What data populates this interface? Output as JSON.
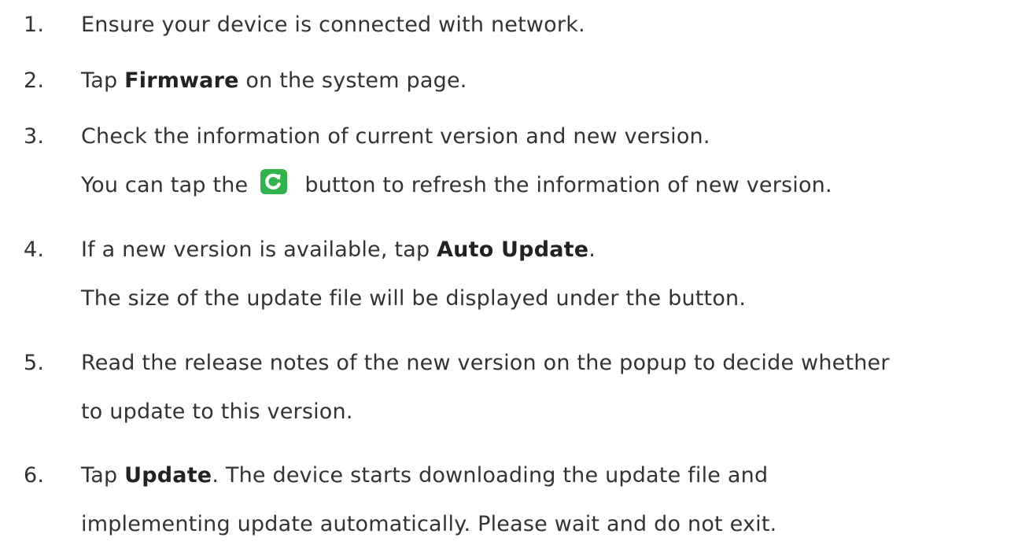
{
  "colors": {
    "text": "#333333",
    "refresh_button_bg": "#2fb34a",
    "refresh_button_icon": "#ffffff"
  },
  "steps": [
    {
      "number": "1.",
      "lines": [
        {
          "parts": [
            "Ensure your device is connected with network."
          ]
        }
      ]
    },
    {
      "number": "2.",
      "lines": [
        {
          "before": "Tap ",
          "bold": "Firmware",
          "after": " on the system page."
        }
      ]
    },
    {
      "number": "3.",
      "lines": [
        {
          "text": "Check the information of current version and new version."
        },
        {
          "before": "You can tap the",
          "icon": "refresh-icon",
          "after": "button to refresh the information of new version."
        }
      ]
    },
    {
      "number": "4.",
      "lines": [
        {
          "before": "If a new version is available, tap ",
          "bold": "Auto Update",
          "after": "."
        },
        {
          "text": "The size of the update file will be displayed under the button."
        }
      ]
    },
    {
      "number": "5.",
      "lines": [
        {
          "text": "Read the release notes of the new version on the popup to decide whether"
        },
        {
          "text": "to update to this version."
        }
      ]
    },
    {
      "number": "6.",
      "lines": [
        {
          "before": "Tap ",
          "bold": "Update",
          "after": ". The device starts downloading the update file and"
        },
        {
          "text": "implementing update automatically. Please wait and do not exit."
        }
      ]
    }
  ]
}
